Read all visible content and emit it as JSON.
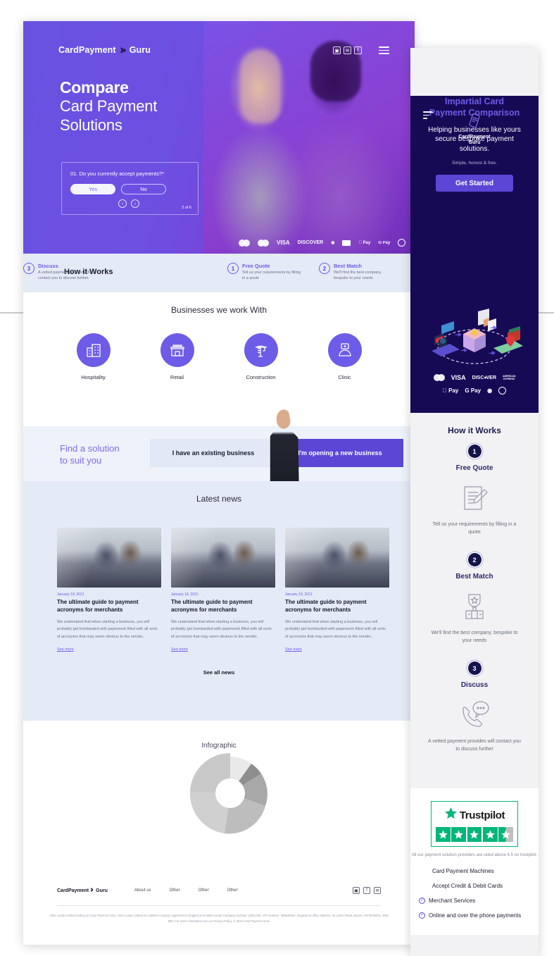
{
  "desktop": {
    "brand": {
      "part1": "CardPayment",
      "icon": "wifi-wave-icon",
      "part2": "Guru"
    },
    "social": [
      {
        "name": "instagram-icon",
        "glyph": "▣"
      },
      {
        "name": "twitter-icon",
        "glyph": "✉"
      },
      {
        "name": "facebook-icon",
        "glyph": "f"
      }
    ],
    "hero": {
      "title_line1": "Compare",
      "title_line2": "Card Payment",
      "title_line3": "Solutions",
      "quiz": {
        "question": "01. Do you currently accept payments?*",
        "yes": "Yes",
        "no": "No",
        "prev_icon": "chevron-left-icon",
        "next_icon": "chevron-right-icon",
        "counter": "2 of 6"
      },
      "payment_logos": [
        "Mastercard",
        "Maestro",
        "VISA",
        "DISCOVER",
        "Diners Club",
        "card",
        "Apple Pay",
        "G Pay",
        "contactless"
      ]
    },
    "how_it_works": {
      "title": "How it Works",
      "steps": [
        {
          "num": "1",
          "head": "Free Quote",
          "body": "Tell us your requirements by filling in a qoute"
        },
        {
          "num": "2",
          "head": "Best Match",
          "body": "We'll find the best company, bespoke to your needs"
        },
        {
          "num": "3",
          "head": "Discuss",
          "body": "A vetted payment provider will contact you to discuss further."
        }
      ]
    },
    "businesses": {
      "title": "Businesses we work With",
      "items": [
        {
          "label": "Hospitality",
          "icon": "building-icon"
        },
        {
          "label": "Retail",
          "icon": "shop-icon"
        },
        {
          "label": "Construction",
          "icon": "crane-icon"
        },
        {
          "label": "Clinic",
          "icon": "nurse-icon"
        }
      ]
    },
    "find_solution": {
      "title_line1": "Find a solution",
      "title_line2": "to suit you",
      "tab_existing": "I have an existing business",
      "tab_new": "I'm opening a new business"
    },
    "news": {
      "title": "Latest news",
      "see_all": "See all news",
      "cards": [
        {
          "date": "January 18, 2021",
          "head": "The ultimate guide to payment acronyms for merchants",
          "body": "We understand that when starting a business, you will probably get bombarded with paperwork filled with all sorts of acronyms that may seem obvious to the sender,",
          "more": "See more"
        },
        {
          "date": "January 18, 2021",
          "head": "The ultimate guide to payment acronyms for merchants",
          "body": "We understand that when starting a business, you will probably get bombarded with paperwork filled with all sorts of acronyms that may seem obvious to the sender,",
          "more": "See more"
        },
        {
          "date": "January 18, 2021",
          "head": "The ultimate guide to payment acronyms for merchants",
          "body": "We understand that when starting a business, you will probably get bombarded with paperwork filled with all sorts of acronyms that may seem obvious to the sender,",
          "more": "See more"
        }
      ]
    },
    "infographic": {
      "title": "Infographic"
    },
    "footer": {
      "brand_part1": "CardPayment",
      "brand_part2": "Guru",
      "nav": [
        "About us",
        "Other",
        "Other",
        "Other"
      ],
      "social": [
        {
          "name": "instagram-icon",
          "glyph": "▣"
        },
        {
          "name": "facebook-icon",
          "glyph": "f"
        },
        {
          "name": "twitter-icon",
          "glyph": "✉"
        }
      ],
      "legal": "ANG Leads Limited trading as Card Payment Guru. ANG Leads Limited is a limited company registered in England and Wales under Company Number 13821756. VAT Number: 358645542. Registered office address: 42 Lytton Road, Barnet, Hertfordshire, EN5 5BY. For more information see our Privacy Policy. © 2020 Card Payment Guru"
    }
  },
  "mobile": {
    "menu_icon": "hamburger-menu-icon",
    "logo_icon": "card-terminal-icon",
    "logo_line1": "CardPayment",
    "logo_line2": "Guru",
    "headline_line1": "Impartial Card",
    "headline_line2": "Payment Comparison",
    "subhead": "Helping businesses like yours secure bespoke payment solutions.",
    "note": "Simple, honest & free.",
    "cta": "Get Started",
    "payment_logos_row1": [
      "Mastercard",
      "VISA",
      "DISCOVER",
      "AMERICAN EXPRESS"
    ],
    "payment_logos_row2": [
      "Apple Pay",
      "G Pay",
      "Diners Club",
      "contactless"
    ],
    "how_it_works": {
      "title": "How it Works",
      "steps": [
        {
          "num": "1",
          "head": "Free Quote",
          "icon": "document-pencil-icon",
          "body": "Tell us your requirements by filling in a quote"
        },
        {
          "num": "2",
          "head": "Best Match",
          "icon": "trophy-icon",
          "body": "We'll find the best company, bespoke to your needs"
        },
        {
          "num": "3",
          "head": "Discuss",
          "icon": "phone-chat-icon",
          "body": "A vetted payment provides will contact you to discuss further"
        }
      ]
    },
    "trustpilot": {
      "name": "Trustpilot",
      "star_icon": "star-icon",
      "stars": 4.5,
      "note": "All our payment solution providers are rated above 4.5 on trustpilot.",
      "items": [
        {
          "label": "Card Payment Machines",
          "ticked": false
        },
        {
          "label": "Accept Credit & Debit Cards",
          "ticked": false
        },
        {
          "label": "Merchant Services",
          "ticked": true
        },
        {
          "label": "Online and over the phone payments",
          "ticked": true
        }
      ]
    }
  },
  "colors": {
    "purple": "#6c5ce7",
    "deep_purple": "#5b46d6",
    "navy": "#170a55",
    "light_blue": "#e4eaf6",
    "trust_green": "#00b67a"
  }
}
